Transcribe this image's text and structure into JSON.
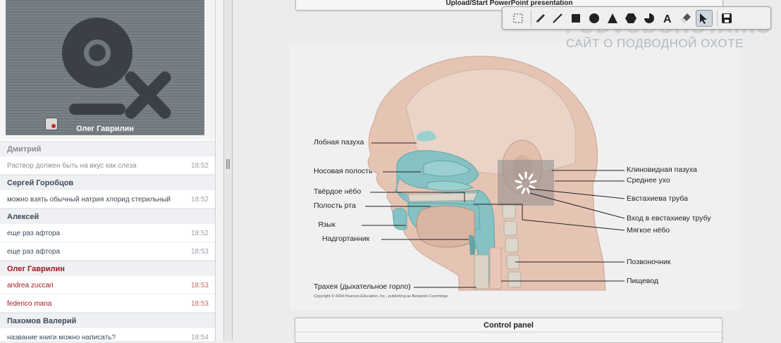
{
  "video": {
    "participant_name": "Олег Гаврилин",
    "camera_icon": "webcam-icon"
  },
  "chat": [
    {
      "user": "Дмитрий",
      "color": "grey",
      "messages": [
        {
          "text": "Раствор должен быть на вкус как слеза",
          "time": "18:52"
        }
      ]
    },
    {
      "user": "Сергей Горобцов",
      "color": "dark",
      "messages": [
        {
          "text": "можно взять обычный натрия хлорид стерильный",
          "time": "18:52"
        }
      ]
    },
    {
      "user": "Алексей",
      "color": "dark",
      "messages": [
        {
          "text": "еще раз афтора",
          "time": "18:52"
        },
        {
          "text": "еще раз афтора",
          "time": "18:53"
        }
      ]
    },
    {
      "user": "Олег Гаврилин",
      "color": "red",
      "messages": [
        {
          "text": "andrea zuccari",
          "time": "18:53"
        },
        {
          "text": "federico mana",
          "time": "18:53"
        }
      ]
    },
    {
      "user": "Пахомов Валерий",
      "color": "dark",
      "messages": [
        {
          "text": "название книги можно написать?",
          "time": "18:54"
        }
      ]
    }
  ],
  "main": {
    "upload_label": "Upload/Start PowerPoint presentation",
    "control_panel_label": "Control panel",
    "toolbar": [
      "select-rectangle-icon",
      "pencil-icon",
      "line-icon",
      "filled-square-icon",
      "filled-circle-icon",
      "filled-triangle-icon",
      "filled-hexagon-icon",
      "pie-icon",
      "text-icon",
      "eraser-icon",
      "pointer-arrow-icon",
      "save-icon"
    ],
    "watermark": {
      "brand": "PODVODOHOTA.RU",
      "tagline": "САЙТ О ПОДВОДНОЙ ОХОТЕ"
    }
  },
  "slide": {
    "labels_left": [
      "Лобная пазуха",
      "Носовая полость",
      "Твёрдое нёбо",
      "Полость рта",
      "Язык",
      "Надгортанник",
      "Трахея (дыхательное горло)"
    ],
    "labels_right": [
      "Клиновидная пазуха",
      "Среднее ухо",
      "Евстахиева труба",
      "Вход в евстахиеву трубу",
      "Мягкое нёбо",
      "Позвоночник",
      "Пищевод"
    ],
    "copyright": "Copyright © 2004 Pearson Education, Inc., publishing as Benjamin Cummings"
  },
  "colors": {
    "skin": "#e6c4b4",
    "bone": "#ddd6cb",
    "airway": "#86c1c3",
    "airway_dark": "#5fa6a9",
    "chat_red": "#a0171e",
    "chat_dark": "#3d4b57"
  }
}
